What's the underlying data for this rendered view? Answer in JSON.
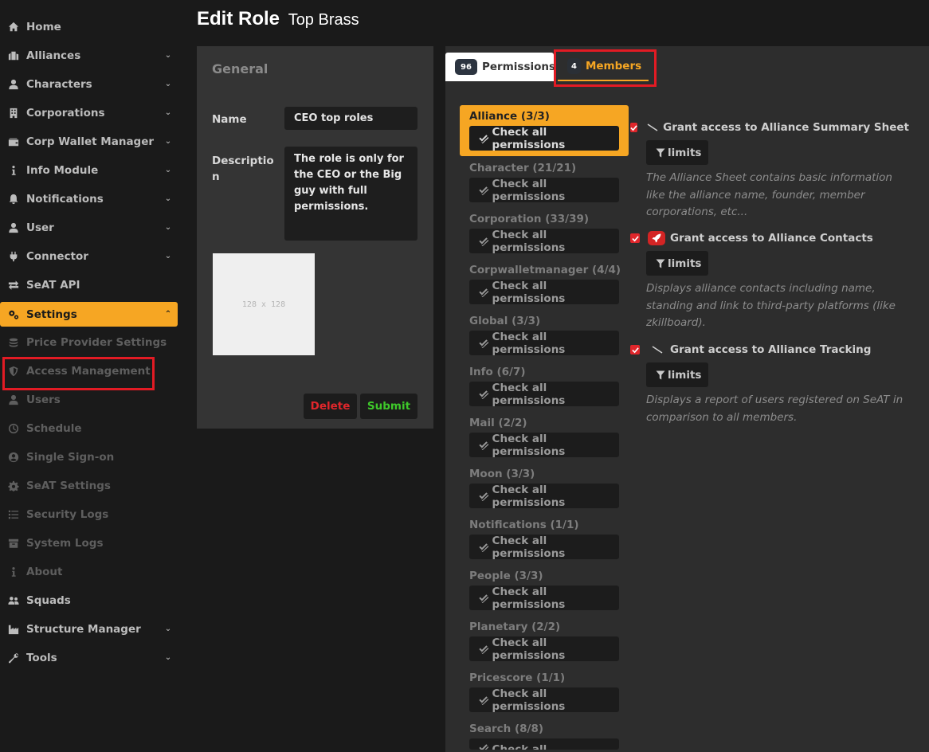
{
  "sidebar": {
    "items": [
      {
        "label": "Home",
        "icon": "home-icon",
        "chevron": ""
      },
      {
        "label": "Alliances",
        "icon": "alliances-icon",
        "chevron": "⌄"
      },
      {
        "label": "Characters",
        "icon": "user-icon",
        "chevron": "⌄"
      },
      {
        "label": "Corporations",
        "icon": "building-icon",
        "chevron": "⌄"
      },
      {
        "label": "Corp Wallet Manager",
        "icon": "wallet-icon",
        "chevron": "⌄"
      },
      {
        "label": "Info Module",
        "icon": "info-icon",
        "chevron": "⌄"
      },
      {
        "label": "Notifications",
        "icon": "bell-icon",
        "chevron": "⌄"
      },
      {
        "label": "User",
        "icon": "user-icon",
        "chevron": "⌄"
      },
      {
        "label": "Connector",
        "icon": "plug-icon",
        "chevron": "⌄"
      },
      {
        "label": "SeAT API",
        "icon": "exchange-icon",
        "chevron": ""
      },
      {
        "label": "Settings",
        "icon": "cogs-icon",
        "chevron": "⌃"
      },
      {
        "label": "Price Provider Settings",
        "icon": "coins-icon",
        "chevron": ""
      },
      {
        "label": "Access Management",
        "icon": "shield-icon",
        "chevron": ""
      },
      {
        "label": "Users",
        "icon": "user-icon",
        "chevron": ""
      },
      {
        "label": "Schedule",
        "icon": "clock-icon",
        "chevron": ""
      },
      {
        "label": "Single Sign-on",
        "icon": "user-circle-icon",
        "chevron": ""
      },
      {
        "label": "SeAT Settings",
        "icon": "cog-icon",
        "chevron": ""
      },
      {
        "label": "Security Logs",
        "icon": "list-icon",
        "chevron": ""
      },
      {
        "label": "System Logs",
        "icon": "archive-icon",
        "chevron": ""
      },
      {
        "label": "About",
        "icon": "info-icon",
        "chevron": ""
      },
      {
        "label": "Squads",
        "icon": "users-icon",
        "chevron": ""
      },
      {
        "label": "Structure Manager",
        "icon": "industry-icon",
        "chevron": "⌄"
      },
      {
        "label": "Tools",
        "icon": "wrench-icon",
        "chevron": "⌄"
      }
    ]
  },
  "header": {
    "title": "Edit Role",
    "subtitle": "Top Brass"
  },
  "general": {
    "title": "General",
    "name_label": "Name",
    "name_value": "CEO top roles",
    "description_label_1": "Descriptio",
    "description_label_2": "n",
    "description_value": "The role is only for the CEO or the Big guy with full permissions.",
    "image_text": "128 x 128",
    "delete_label": "Delete",
    "submit_label": "Submit"
  },
  "tabs": {
    "permissions_count": "96",
    "permissions_label": "Permissions",
    "members_count": "4",
    "members_label": "Members"
  },
  "categories": [
    {
      "label": "Alliance (3/3)",
      "button": "Check all permissions"
    },
    {
      "label": "Character (21/21)",
      "button": "Check all permissions"
    },
    {
      "label": "Corporation (33/39)",
      "button": "Check all permissions"
    },
    {
      "label": "Corpwalletmanager (4/4)",
      "button": "Check all permissions"
    },
    {
      "label": "Global (3/3)",
      "button": "Check all permissions"
    },
    {
      "label": "Info (6/7)",
      "button": "Check all permissions"
    },
    {
      "label": "Mail (2/2)",
      "button": "Check all permissions"
    },
    {
      "label": "Moon (3/3)",
      "button": "Check all permissions"
    },
    {
      "label": "Notifications (1/1)",
      "button": "Check all permissions"
    },
    {
      "label": "People (3/3)",
      "button": "Check all permissions"
    },
    {
      "label": "Planetary (2/2)",
      "button": "Check all permissions"
    },
    {
      "label": "Pricescore (1/1)",
      "button": "Check all permissions"
    },
    {
      "label": "Search (8/8)",
      "button": "Check all permissions"
    }
  ],
  "permissions": [
    {
      "title": "Grant access to Alliance Summary Sheet",
      "limits": "limits",
      "description": "The Alliance Sheet contains basic information like the alliance name, founder, member corporations, etc...",
      "icon": "slash-icon"
    },
    {
      "title": "Grant access to Alliance Contacts",
      "limits": "limits",
      "description": "Displays alliance contacts including name, standing and link to third-party platforms (like zkillboard).",
      "icon": "rocket-icon"
    },
    {
      "title": "Grant access to Alliance Tracking",
      "limits": "limits",
      "description": "Displays a report of users registered on SeAT in comparison to all members.",
      "icon": "slash-icon"
    }
  ],
  "colors": {
    "accent": "#f6a623",
    "highlight": "#e21b24",
    "delete": "#e0262b",
    "submit": "#3ec82a",
    "checkbox": "#e0262b"
  }
}
